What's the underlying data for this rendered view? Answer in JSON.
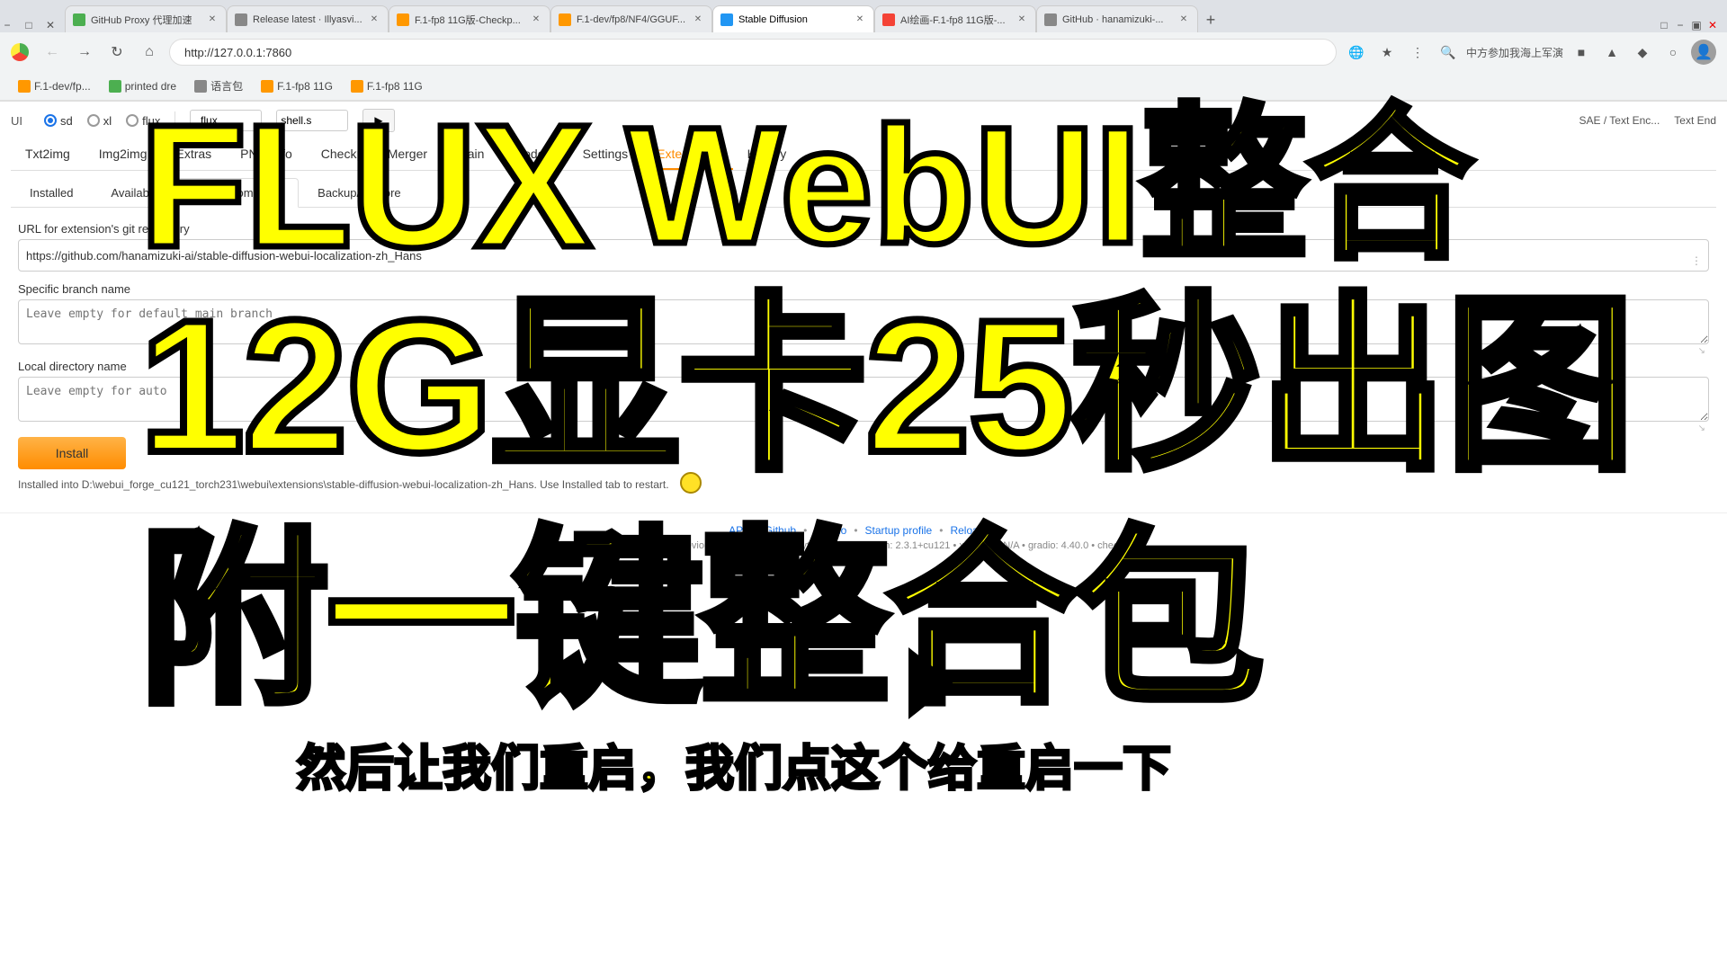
{
  "browser": {
    "tabs": [
      {
        "id": "tab1",
        "title": "GitHub Proxy 代理加速",
        "favicon_color": "#4caf50",
        "active": false
      },
      {
        "id": "tab2",
        "title": "Release latest · Illyasvi...",
        "favicon_color": "#888",
        "active": false
      },
      {
        "id": "tab3",
        "title": "F.1-fp8 11G版-Checkp...",
        "favicon_color": "#ff9800",
        "active": false
      },
      {
        "id": "tab4",
        "title": "F.1-dev/fp8/NF4/GGUF...",
        "favicon_color": "#ff9800",
        "active": false
      },
      {
        "id": "tab5",
        "title": "Stable Diffusion",
        "favicon_color": "#2196f3",
        "active": true
      },
      {
        "id": "tab6",
        "title": "AI绘画-F.1-fp8 11G版-...",
        "favicon_color": "#f44336",
        "active": false
      },
      {
        "id": "tab7",
        "title": "GitHub · hanamizuki-...",
        "favicon_color": "#888",
        "active": false
      }
    ],
    "address": "http://127.0.0.1:7860",
    "search_hint": "中方参加我海上军演"
  },
  "bookmarks": [
    {
      "label": "F.1-dev/fp..."
    },
    {
      "label": "语言包"
    },
    {
      "label": "F.1-fp8 11G"
    },
    {
      "label": "F.1-fp8 11G"
    }
  ],
  "webui": {
    "ui_label": "UI",
    "radio_options": [
      "sd",
      "xl",
      "flux"
    ],
    "radio_selected": "sd",
    "flux_placeholder": "_flux",
    "shell_placeholder": "shell.s",
    "more_placeholder": "...",
    "main_tabs": [
      "Txt2img",
      "Img2img",
      "Extras",
      "PNG Info",
      "Checkpoint Merger",
      "Train",
      "Models",
      "Settings",
      "Extensions",
      "History"
    ],
    "ext_tabs": [
      "Installed",
      "Available",
      "Install from URL",
      "Backup/Restore"
    ],
    "ext_tab_active": "Install from URL",
    "url_label": "URL for extension's git repository",
    "url_value": "https://github.com/hanamizuki-ai/stable-diffusion-webui-localization-zh_Hans",
    "branch_label": "Specific branch name",
    "branch_placeholder": "Leave empty for default main branch",
    "dir_label": "Local directory name",
    "dir_placeholder": "Leave empty for auto",
    "install_btn": "Install",
    "status_message": "Installed into D:\\webui_forge_cu121_torch231\\webui\\extensions\\stable-diffusion-webui-localization-zh_Hans. Use Installed tab to restart."
  },
  "footer": {
    "links": [
      "API",
      "Github",
      "Gradio",
      "Startup profile",
      "Reload UI"
    ],
    "version_info": "version: f2.0.1v1.10.1-previous-527-g720b80da  •  python: 3.10.6  •  torch: 2.3.1+cu121  •  xformers: N/A  •  gradio: 4.40.0  •  checkpoint:"
  },
  "overlay": {
    "text1": "FLUX    WebUI整合",
    "text2": "12G显卡25秒出图",
    "text3": "附一键整合包",
    "text4": "然后让我们重启，我们点这个给重启一下"
  }
}
